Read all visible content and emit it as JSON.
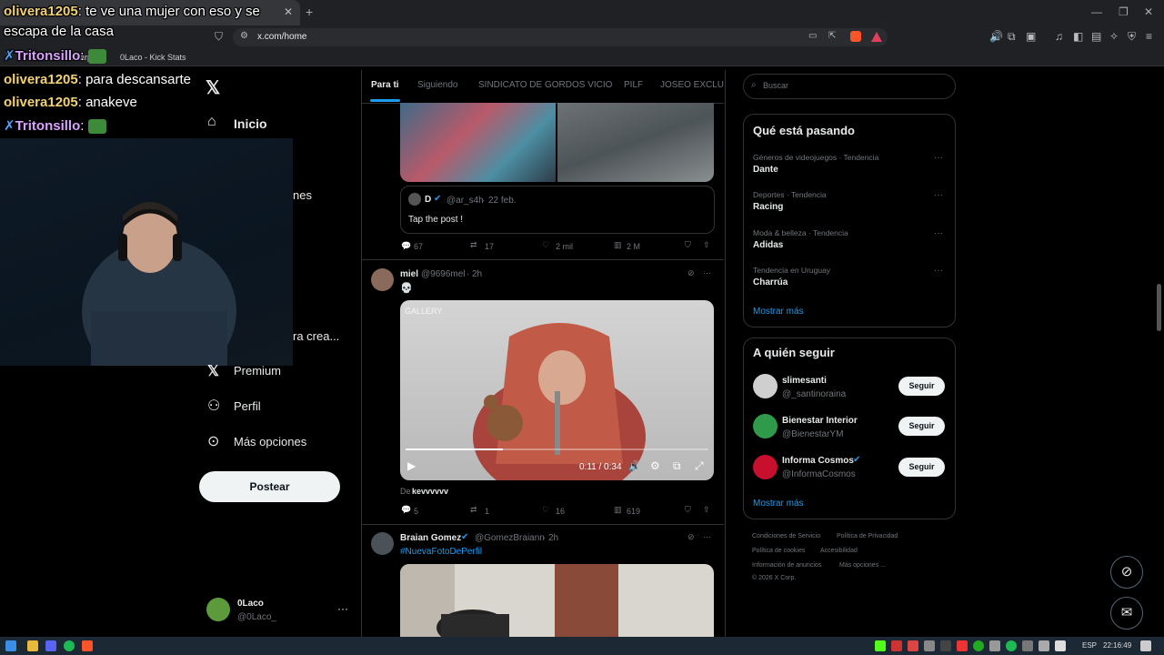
{
  "browser": {
    "tab_title": "olivera1205: te ve una mujer con eso y se escapa de la casa",
    "url": "x.com/home",
    "bookmarks": [
      "Nueva carpeta",
      "0Laco - Kick Stats"
    ]
  },
  "chat": [
    {
      "user": "olivera1205",
      "text": "te ve una mujer con eso y se"
    },
    {
      "user": "",
      "text": "escapa de la casa"
    },
    {
      "user": "Tritonsillo",
      "text": ""
    },
    {
      "user": "olivera1205",
      "text": "para descansarte"
    },
    {
      "user": "olivera1205",
      "text": "anakeve"
    },
    {
      "user": "Tritonsillo",
      "text": ""
    }
  ],
  "nav": {
    "home": "Inicio",
    "partial1": "nes",
    "partial2": "ra crea...",
    "premium": "Premium",
    "profile": "Perfil",
    "more": "Más opciones",
    "post_button": "Postear",
    "account_name": "0Laco",
    "account_handle": "@0Laco_"
  },
  "timeline": {
    "tabs": [
      "Para ti",
      "Siguiendo",
      "SINDICATO DE GORDOS VICIO",
      "PILF",
      "JOSEO EXCLUSI"
    ],
    "quoted": {
      "name": "D",
      "handle": "@ar_s4h",
      "date": "22 feb.",
      "text": "Tap the post !"
    },
    "post1_actions": {
      "replies": "67",
      "reposts": "17",
      "likes": "2 mil",
      "views": "2 M"
    },
    "post2": {
      "name": "miel",
      "handle": "@9696mel",
      "time": "2h",
      "text": "💀",
      "video_label": "GALLERY",
      "video_time": "0:11 / 0:34",
      "video_progress": 0.32,
      "from_prefix": "De",
      "from_user": "kevvvvvv",
      "actions": {
        "replies": "5",
        "reposts": "1",
        "likes": "16",
        "views": "619"
      }
    },
    "post3": {
      "name": "Braian Gomez",
      "handle": "@GomezBraiann",
      "time": "2h",
      "text": "#NuevaFotoDePerfil"
    }
  },
  "right": {
    "search_placeholder": "Buscar",
    "trending_title": "Qué está pasando",
    "trends": [
      {
        "meta": "Géneros de videojuegos · Tendencia",
        "name": "Dante"
      },
      {
        "meta": "Deportes · Tendencia",
        "name": "Racing"
      },
      {
        "meta": "Moda & belleza · Tendencia",
        "name": "Adidas"
      },
      {
        "meta": "Tendencia en Uruguay",
        "name": "Charrúa"
      }
    ],
    "show_more": "Mostrar más",
    "follow_title": "A quién seguir",
    "follow": [
      {
        "name": "slimesanti",
        "handle": "@_santinoraina"
      },
      {
        "name": "Bienestar Interior",
        "handle": "@BienestarYM"
      },
      {
        "name": "Informa Cosmos",
        "handle": "@InformaCosmos"
      }
    ],
    "follow_button": "Seguir",
    "footer": [
      "Condiciones de Servicio",
      "Política de Privacidad",
      "Política de cookies",
      "Accesibilidad",
      "Información de anuncios",
      "Más opciones ...",
      "© 2026 X Corp."
    ]
  },
  "taskbar": {
    "lang": "ESP",
    "time": "22:16:49"
  },
  "colors": {
    "accent": "#1d9bf0",
    "bg": "#000000",
    "border": "#2f3336"
  }
}
